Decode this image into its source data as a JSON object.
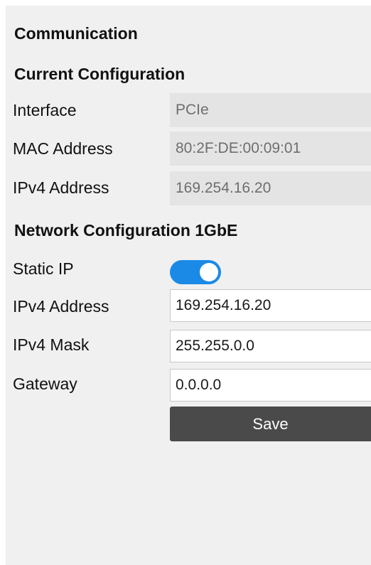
{
  "title": "Communication",
  "current_config": {
    "heading": "Current Configuration",
    "rows": [
      {
        "label": "Interface",
        "value": "PCIe"
      },
      {
        "label": "MAC Address",
        "value": "80:2F:DE:00:09:01"
      },
      {
        "label": "IPv4 Address",
        "value": "169.254.16.20"
      }
    ]
  },
  "network_config": {
    "heading": "Network Configuration 1GbE",
    "static_ip": {
      "label": "Static IP",
      "enabled": true
    },
    "fields": [
      {
        "label": "IPv4 Address",
        "value": "169.254.16.20"
      },
      {
        "label": "IPv4 Mask",
        "value": "255.255.0.0"
      },
      {
        "label": "Gateway",
        "value": "0.0.0.0"
      }
    ],
    "save_label": "Save"
  },
  "colors": {
    "panel_bg": "#f0f0f0",
    "readonly_bg": "#e4e4e4",
    "toggle_on": "#1a8ae6",
    "button_bg": "#4a4a4a"
  }
}
